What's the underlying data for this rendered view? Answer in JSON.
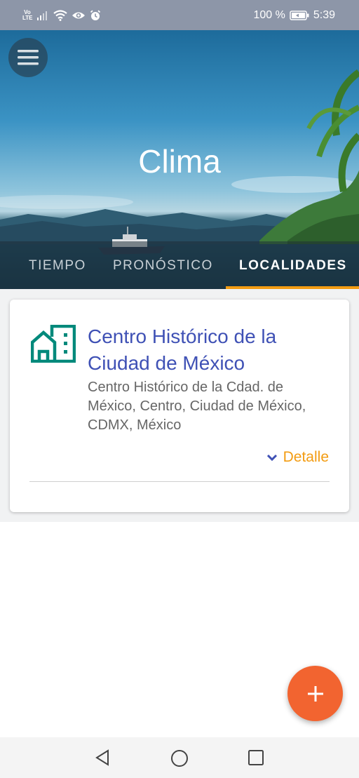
{
  "status_bar": {
    "network_label": "Vo LTE",
    "battery_percent": "100 %",
    "time": "5:39",
    "icons": [
      "volte-icon",
      "signal-icon",
      "wifi-icon",
      "eye-icon",
      "alarm-icon",
      "battery-icon"
    ]
  },
  "header": {
    "menu_icon": "hamburger-menu-icon",
    "title": "Clima",
    "tabs": [
      {
        "label": "TIEMPO",
        "active": false
      },
      {
        "label": "PRONÓSTICO",
        "active": false
      },
      {
        "label": "LOCALIDADES",
        "active": true
      }
    ],
    "active_tab_color": "#f39c12"
  },
  "locations": [
    {
      "icon": "city-building-icon",
      "name": "Centro Histórico de la Ciudad de México",
      "address": "Centro Histórico de la Cdad. de México, Centro, Ciudad de México, CDMX, México",
      "detail_label": "Detalle",
      "detail_icon": "chevron-down-icon"
    }
  ],
  "fab": {
    "icon": "plus-icon",
    "color": "#f26430"
  },
  "nav_bar": {
    "icons": [
      "back-icon",
      "home-icon",
      "recents-icon"
    ]
  },
  "colors": {
    "title_blue": "#3f51b5",
    "accent_orange": "#f39c12",
    "icon_teal": "#00897b"
  }
}
